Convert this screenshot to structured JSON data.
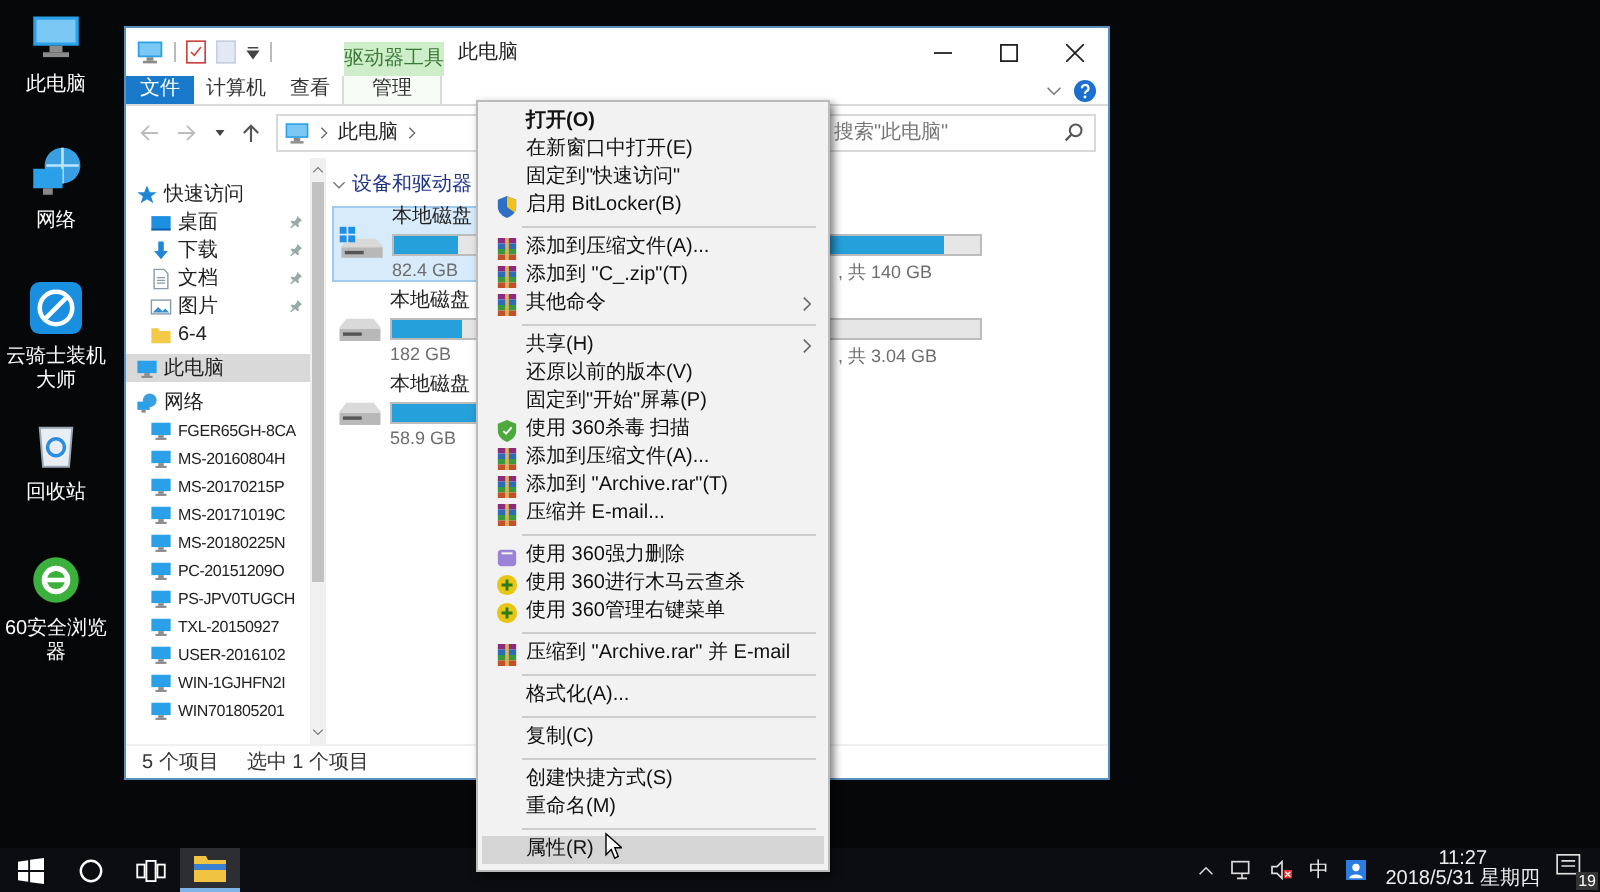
{
  "desktop_icons": [
    {
      "label": "此电脑",
      "kind": "computer"
    },
    {
      "label": "网络",
      "kind": "network"
    },
    {
      "label": "云骑士装机大师",
      "kind": "app"
    },
    {
      "label": "回收站",
      "kind": "recycle"
    },
    {
      "label": "60安全浏览器",
      "kind": "browser"
    }
  ],
  "window": {
    "title": "此电脑",
    "context_tab": "驱动器工具",
    "ribbon_tabs": [
      {
        "label": "文件",
        "kind": "file",
        "selected": false
      },
      {
        "label": "计算机",
        "kind": "tab",
        "selected": false
      },
      {
        "label": "查看",
        "kind": "tab",
        "selected": false
      },
      {
        "label": "管理",
        "kind": "context",
        "selected": false
      }
    ],
    "address": {
      "path": "此电脑"
    },
    "search": {
      "placeholder": "搜索\"此电脑\""
    },
    "sidebar": {
      "items": [
        {
          "label": "快速访问",
          "kind": "star",
          "selected": false,
          "children": [
            {
              "label": "桌面",
              "kind": "desktop",
              "pinned": true,
              "selected": false
            },
            {
              "label": "下载",
              "kind": "download",
              "pinned": true,
              "selected": false
            },
            {
              "label": "文档",
              "kind": "document",
              "pinned": true,
              "selected": false
            },
            {
              "label": "图片",
              "kind": "picture",
              "pinned": true,
              "selected": false
            },
            {
              "label": "6-4",
              "kind": "folder",
              "pinned": false,
              "selected": false
            }
          ]
        },
        {
          "label": "此电脑",
          "kind": "computer",
          "selected": true
        },
        {
          "label": "网络",
          "kind": "network",
          "selected": false,
          "children": [
            {
              "label": "FGER65GH-8CA",
              "kind": "pc",
              "selected": false
            },
            {
              "label": "MS-20160804H",
              "kind": "pc",
              "selected": false
            },
            {
              "label": "MS-20170215P",
              "kind": "pc",
              "selected": false
            },
            {
              "label": "MS-20171019C",
              "kind": "pc",
              "selected": false
            },
            {
              "label": "MS-20180225N",
              "kind": "pc",
              "selected": false
            },
            {
              "label": "PC-20151209O",
              "kind": "pc",
              "selected": false
            },
            {
              "label": "PS-JPV0TUGCH",
              "kind": "pc",
              "selected": false
            },
            {
              "label": "TXL-20150927",
              "kind": "pc",
              "selected": false
            },
            {
              "label": "USER-2016102",
              "kind": "pc",
              "selected": false
            },
            {
              "label": "WIN-1GJHFN2I",
              "kind": "pc",
              "selected": false
            },
            {
              "label": "WIN701805201",
              "kind": "pc",
              "selected": false
            }
          ]
        }
      ]
    },
    "section": {
      "title": "设备和驱动器",
      "drives": [
        {
          "label": "本地磁盘",
          "capacity": "82.4 GB",
          "kind": "system",
          "level": 0.45,
          "selected": true
        },
        {
          "capacity": ", 共 140 GB",
          "kind": "hidden",
          "level": 0.9,
          "selected": false
        },
        {
          "label": "本地磁盘",
          "capacity": "182 GB",
          "kind": "disk",
          "level": 0.5,
          "selected": false
        },
        {
          "capacity": ", 共 3.04 GB",
          "kind": "hidden",
          "level": 0.05,
          "selected": false
        },
        {
          "label": "本地磁盘",
          "capacity": "58.9 GB",
          "kind": "disk",
          "level": 0.7,
          "selected": false
        }
      ]
    },
    "status_bar": {
      "count": "5 个项目",
      "selection": "选中 1 个项目"
    }
  },
  "context_menu": {
    "groups": [
      [
        {
          "label": "打开(O)",
          "kind": "none",
          "default": true,
          "submenu": false,
          "selected": false
        },
        {
          "label": "在新窗口中打开(E)",
          "kind": "none",
          "default": false,
          "submenu": false,
          "selected": false
        },
        {
          "label": "固定到\"快速访问\"",
          "kind": "none",
          "default": false,
          "submenu": false,
          "selected": false
        },
        {
          "label": "启用 BitLocker(B)",
          "kind": "shield",
          "default": false,
          "submenu": false,
          "selected": false
        }
      ],
      [
        {
          "label": "添加到压缩文件(A)...",
          "kind": "archive",
          "default": false,
          "submenu": false,
          "selected": false
        },
        {
          "label": "添加到 \"C_.zip\"(T)",
          "kind": "archive",
          "default": false,
          "submenu": false,
          "selected": false
        },
        {
          "label": "其他命令",
          "kind": "archive",
          "default": false,
          "submenu": true,
          "selected": false
        }
      ],
      [
        {
          "label": "共享(H)",
          "kind": "none",
          "default": false,
          "submenu": true,
          "selected": false
        },
        {
          "label": "还原以前的版本(V)",
          "kind": "none",
          "default": false,
          "submenu": false,
          "selected": false
        },
        {
          "label": "固定到\"开始\"屏幕(P)",
          "kind": "none",
          "default": false,
          "submenu": false,
          "selected": false
        },
        {
          "label": "使用 360杀毒 扫描",
          "kind": "green-shield",
          "default": false,
          "submenu": false,
          "selected": false
        },
        {
          "label": "添加到压缩文件(A)...",
          "kind": "archive",
          "default": false,
          "submenu": false,
          "selected": false
        },
        {
          "label": "添加到 \"Archive.rar\"(T)",
          "kind": "archive",
          "default": false,
          "submenu": false,
          "selected": false
        },
        {
          "label": "压缩并 E-mail...",
          "kind": "archive",
          "default": false,
          "submenu": false,
          "selected": false
        }
      ],
      [
        {
          "label": "使用 360强力删除",
          "kind": "box",
          "default": false,
          "submenu": false,
          "selected": false
        },
        {
          "label": "使用 360进行木马云查杀",
          "kind": "plus",
          "default": false,
          "submenu": false,
          "selected": false
        },
        {
          "label": "使用 360管理右键菜单",
          "kind": "plus",
          "default": false,
          "submenu": false,
          "selected": false
        }
      ],
      [
        {
          "label": "压缩到 \"Archive.rar\" 并 E-mail",
          "kind": "archive",
          "default": false,
          "submenu": false,
          "selected": false
        }
      ],
      [
        {
          "label": "格式化(A)...",
          "kind": "none",
          "default": false,
          "submenu": false,
          "selected": false
        }
      ],
      [
        {
          "label": "复制(C)",
          "kind": "none",
          "default": false,
          "submenu": false,
          "selected": false
        }
      ],
      [
        {
          "label": "创建快捷方式(S)",
          "kind": "none",
          "default": false,
          "submenu": false,
          "selected": false
        },
        {
          "label": "重命名(M)",
          "kind": "none",
          "default": false,
          "submenu": false,
          "selected": false
        }
      ],
      [
        {
          "label": "属性(R)",
          "kind": "none",
          "default": false,
          "submenu": false,
          "selected": true
        }
      ]
    ]
  },
  "taskbar": {
    "apps": [
      {
        "kind": "start",
        "active": false
      },
      {
        "kind": "search",
        "active": false
      },
      {
        "kind": "taskview",
        "active": false
      },
      {
        "kind": "explorer",
        "active": true
      }
    ],
    "ime": "中",
    "time": "11:27",
    "date": "2018/5/31 星期四",
    "notifications": "19"
  }
}
